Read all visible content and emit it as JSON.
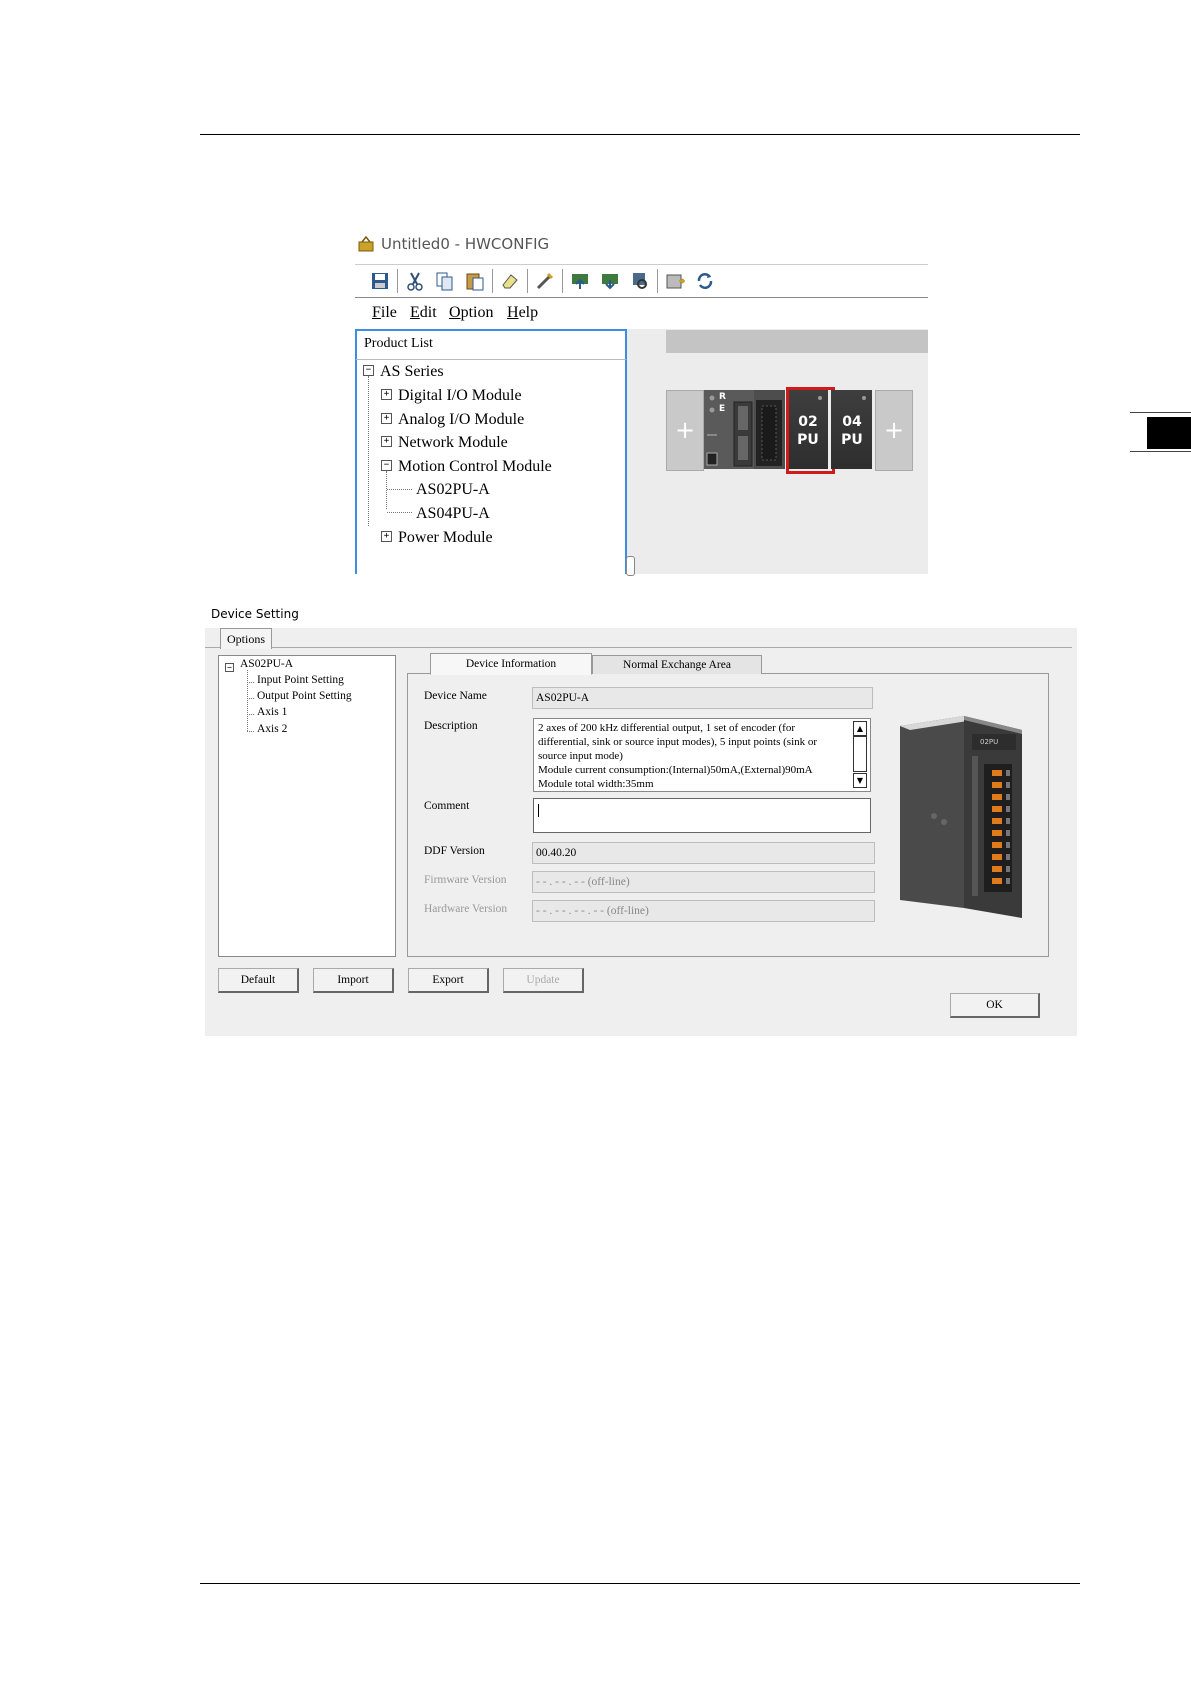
{
  "hwconfig": {
    "title": "Untitled0 - HWCONFIG",
    "menu": [
      "File",
      "Edit",
      "Option",
      "Help"
    ],
    "product_list": {
      "header": "Product List",
      "root": "AS Series",
      "items": [
        "Digital I/O Module",
        "Analog I/O Module",
        "Network Module",
        "Motion Control Module",
        "AS02PU-A",
        "AS04PU-A",
        "Power Module"
      ]
    },
    "rack": {
      "cpu_leds": [
        "R",
        "E"
      ],
      "modules": [
        {
          "line1": "02",
          "line2": "PU",
          "selected": true
        },
        {
          "line1": "04",
          "line2": "PU",
          "selected": false
        }
      ],
      "plus": "+",
      "selection_color": "#d11a1a"
    }
  },
  "device_setting": {
    "title": "Device Setting",
    "options_tab": "Options",
    "tree": {
      "root": "AS02PU-A",
      "children": [
        "Input Point Setting",
        "Output Point Setting",
        "Axis 1",
        "Axis 2"
      ]
    },
    "tabs": [
      "Device Information",
      "Normal Exchange Area"
    ],
    "labels": {
      "device_name": "Device Name",
      "description": "Description",
      "comment": "Comment",
      "ddf_version": "DDF Version",
      "firmware_version": "Firmware Version",
      "hardware_version": "Hardware Version"
    },
    "values": {
      "device_name": "AS02PU-A",
      "description": "2 axes of 200 kHz differential output, 1 set of encoder (for differential, sink or source input modes), 5 input points (sink or source input mode)\nModule current consumption:(Internal)50mA,(External)90mA\nModule total width:35mm",
      "comment": "",
      "ddf_version": "00.40.20",
      "firmware_version": "- - . - - . - - (off-line)",
      "hardware_version": "- - . - - . - - . - - (off-line)"
    },
    "image_label": "02PU",
    "buttons": {
      "default": "Default",
      "import": "Import",
      "export": "Export",
      "update": "Update",
      "ok": "OK"
    }
  }
}
